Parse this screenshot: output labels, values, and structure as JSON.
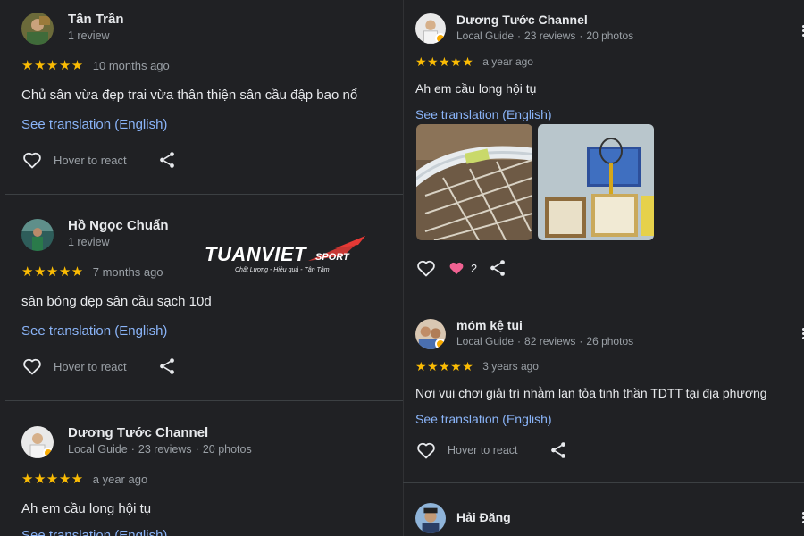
{
  "watermark": {
    "brand": "TUANVIET",
    "brand_suffix": "SPORT",
    "tagline": "Chất Lượng - Hiệu quả - Tận Tâm"
  },
  "left_reviews": [
    {
      "name": "Tân Trần",
      "meta": "1 review",
      "stars": "★★★★★",
      "time": "10 months ago",
      "text": "Chủ sân vừa đẹp trai vừa thân thiện sân cầu đập bao nổ",
      "translate": "See translation (English)",
      "react": "Hover to react"
    },
    {
      "name": "Hồ Ngọc Chuẩn",
      "meta": "1 review",
      "stars": "★★★★★",
      "time": "7 months ago",
      "text": "sân bóng đẹp sân cầu sạch 10đ",
      "translate": "See translation (English)",
      "react": "Hover to react"
    },
    {
      "name": "Dương Tước Channel",
      "meta_role": "Local Guide",
      "meta_reviews": "23 reviews",
      "meta_photos": "20 photos",
      "stars": "★★★★★",
      "time": "a year ago",
      "text": "Ah em cầu long hội tụ",
      "translate": "See translation (English)"
    }
  ],
  "right_reviews": [
    {
      "name": "Dương Tước Channel",
      "meta_role": "Local Guide",
      "meta_reviews": "23 reviews",
      "meta_photos": "20 photos",
      "stars": "★★★★★",
      "time": "a year ago",
      "text": "Ah em cầu long hội tụ",
      "translate": "See translation (English)",
      "likes": "2"
    },
    {
      "name": "móm kệ tui",
      "meta_role": "Local Guide",
      "meta_reviews": "82 reviews",
      "meta_photos": "26 photos",
      "stars": "★★★★★",
      "time": "3 years ago",
      "text": "Nơi vui chơi giải trí nhằm lan tỏa tinh thần TDTT tại địa phương",
      "translate": "See translation (English)",
      "react": "Hover to react"
    },
    {
      "name": "Hải Đăng"
    }
  ],
  "colors": {
    "background": "#202124",
    "star": "#fbbc04",
    "link": "#8ab4f8",
    "liked_heart": "#f06292",
    "local_guide_badge": "#f9ab00"
  },
  "icons": [
    "heart-outline-icon",
    "heart-filled-icon",
    "share-icon",
    "more-vert-icon",
    "local-guide-badge-icon"
  ]
}
